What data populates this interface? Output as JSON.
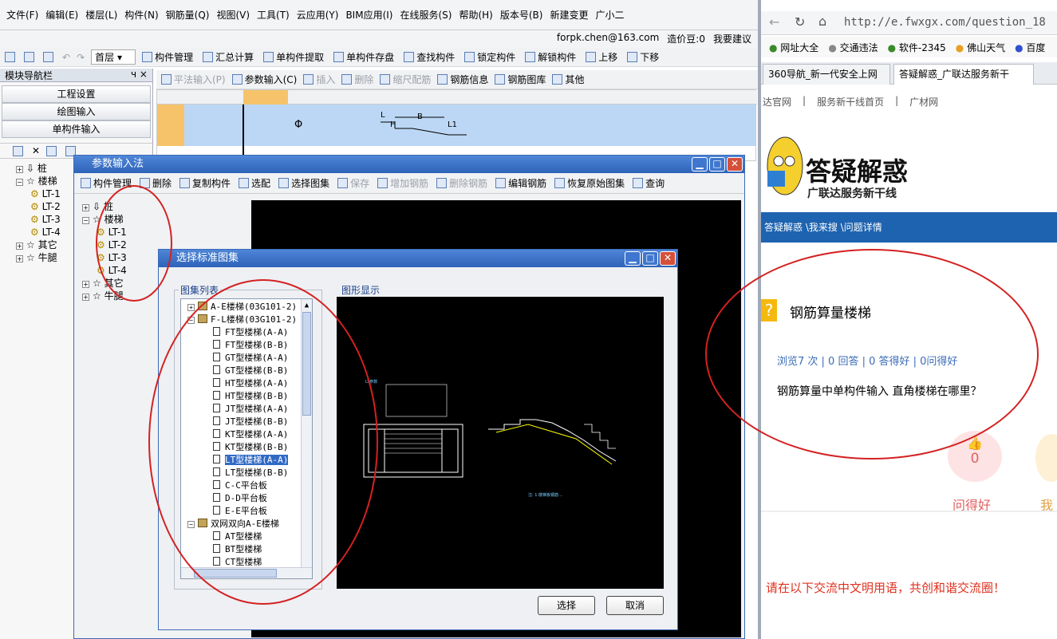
{
  "menu": [
    "文件(F)",
    "编辑(E)",
    "楼层(L)",
    "构件(N)",
    "钢筋量(Q)",
    "视图(V)",
    "工具(T)",
    "云应用(Y)",
    "BIM应用(I)",
    "在线服务(S)",
    "帮助(H)",
    "版本号(B)",
    "新建变更",
    "广小二"
  ],
  "account": {
    "email": "forpk.chen@163.com",
    "price_bean": "造价豆:0",
    "suggest": "我要建议"
  },
  "toolbar1": {
    "floor": "首层",
    "items": [
      "构件管理",
      "汇总计算",
      "单构件提取",
      "单构件存盘",
      "查找构件",
      "锁定构件",
      "解锁构件",
      "上移",
      "下移"
    ]
  },
  "toolbar2": {
    "items": [
      "平法输入(P)",
      "参数输入(C)",
      "插入",
      "删除",
      "缩尺配筋",
      "钢筋信息",
      "钢筋图库",
      "其他"
    ]
  },
  "nav": {
    "title": "模块导航栏",
    "pin": "ч ×",
    "buttons": [
      "工程设置",
      "绘图输入",
      "单构件输入"
    ],
    "tree": [
      "桩",
      "楼梯",
      "LT-1",
      "LT-2",
      "LT-3",
      "LT-4",
      "其它",
      "牛腿"
    ]
  },
  "grid": {
    "symbol": "Φ",
    "shape_l": "L",
    "shape_b": "B",
    "shape_h": "H",
    "shape_l1": "L1"
  },
  "param_window": {
    "title": "参数输入法",
    "toolbar": [
      "构件管理",
      "删除",
      "复制构件",
      "选配",
      "选择图集",
      "保存",
      "增加钢筋",
      "删除钢筋",
      "编辑钢筋",
      "恢复原始图集",
      "查询"
    ],
    "tree": [
      "桩",
      "楼梯",
      "LT-1",
      "LT-2",
      "LT-3",
      "LT-4",
      "其它",
      "牛腿"
    ]
  },
  "dialog": {
    "title": "选择标准图集",
    "list_label": "图集列表",
    "preview_label": "图形显示",
    "items": [
      "A-E楼梯(03G101-2)",
      "F-L楼梯(03G101-2)",
      "FT型楼梯(A-A)",
      "FT型楼梯(B-B)",
      "GT型楼梯(A-A)",
      "GT型楼梯(B-B)",
      "HT型楼梯(A-A)",
      "HT型楼梯(B-B)",
      "JT型楼梯(A-A)",
      "JT型楼梯(B-B)",
      "KT型楼梯(A-A)",
      "KT型楼梯(B-B)",
      "LT型楼梯(A-A)",
      "LT型楼梯(B-B)",
      "C-C平台板",
      "D-D平台板",
      "E-E平台板",
      "双网双向A-E楼梯",
      "AT型楼梯",
      "BT型楼梯",
      "CT型楼梯"
    ],
    "selected_index": 12,
    "ok": "选择",
    "cancel": "取消"
  },
  "browser": {
    "url": "http://e.fwxgx.com/question_18",
    "bookmarks": [
      "网址大全",
      "交通违法",
      "软件-2345",
      "佛山天气",
      "百度"
    ],
    "tabs": [
      "360导航_新一代安全上网",
      "答疑解惑_广联达服务新干"
    ],
    "links": [
      "达官网",
      "服务新干线首页",
      "广材网"
    ],
    "logo": "答疑解惑",
    "logo_sub": "广联达服务新干线",
    "breadcrumb": "答疑解惑 \\我来搜 \\问题详情",
    "question_title": "钢筋算量楼梯",
    "stats": "浏览7 次 | 0 回答 | 0 答得好 | 0问得好",
    "question": "钢筋算量中单构件输入 直角楼梯在哪里？",
    "good_count": "0",
    "good_label": "问得好",
    "me_label": "我",
    "notice": "请在以下交流中文明用语，共创和谐交流圈！"
  },
  "colors": {
    "accent": "#1e63b0",
    "annotation": "#d42121"
  }
}
